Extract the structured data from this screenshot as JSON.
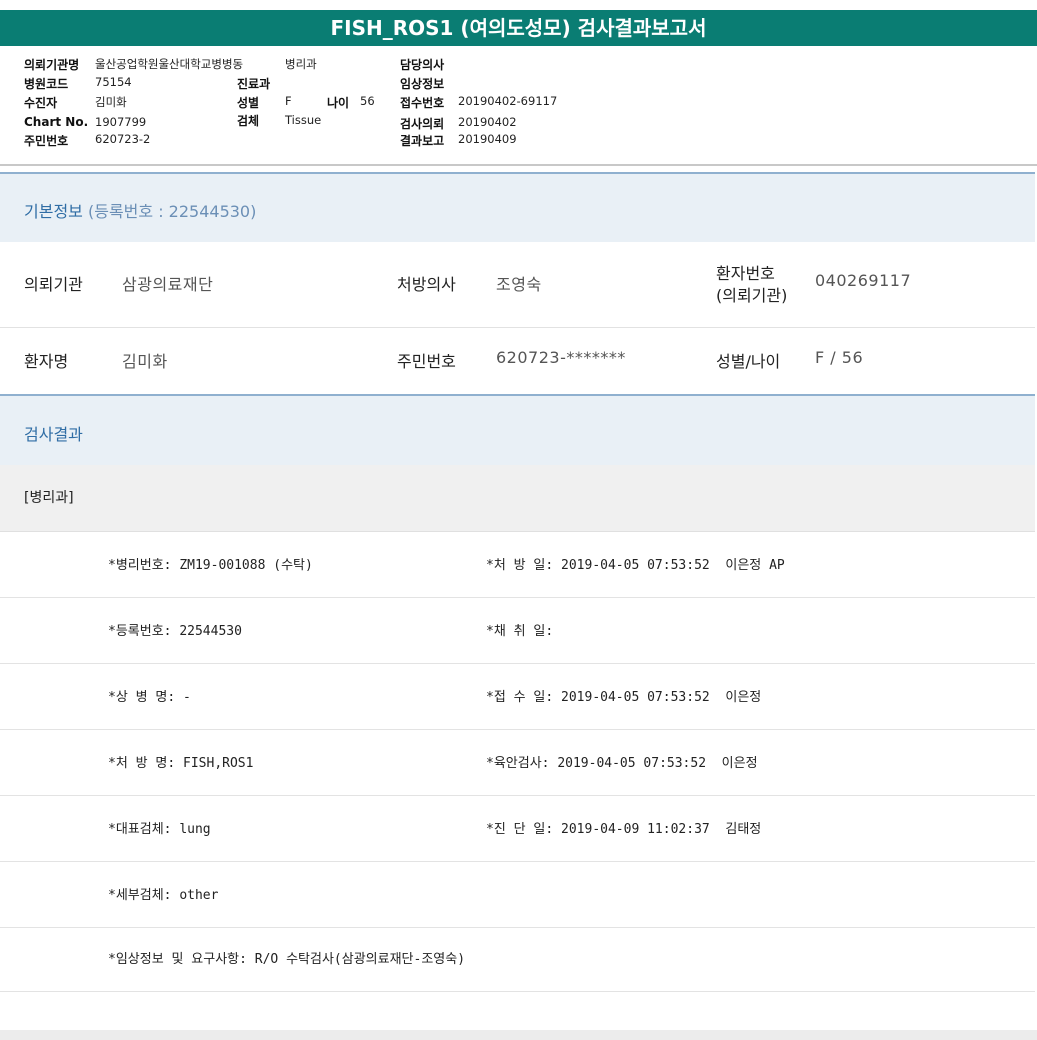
{
  "title": "FISH_ROS1 (여의도성모) 검사결과보고서",
  "header": {
    "requesting_institution": {
      "label": "의뢰기관명",
      "value": "울산공업학원울산대학교병병동"
    },
    "department": {
      "value": "병리과"
    },
    "attending_doctor": {
      "label": "담당의사",
      "value": ""
    },
    "hospital_code": {
      "label": "병원코드",
      "value": "75154"
    },
    "clinic": {
      "label": "진료과",
      "value": ""
    },
    "clinical_info": {
      "label": "임상정보",
      "value": ""
    },
    "patient": {
      "label": "수진자",
      "value": "김미화"
    },
    "sex": {
      "label": "성별",
      "value": "F"
    },
    "age": {
      "label": "나이",
      "value": "56"
    },
    "receipt_no": {
      "label": "접수번호",
      "value": "20190402-69117"
    },
    "chart_no": {
      "label": "Chart No.",
      "value": "1907799"
    },
    "specimen": {
      "label": "검체",
      "value": "Tissue"
    },
    "test_request": {
      "label": "검사의뢰",
      "value": "20190402"
    },
    "resident_no": {
      "label": "주민번호",
      "value": "620723-2"
    },
    "result_report": {
      "label": "결과보고",
      "value": "20190409"
    }
  },
  "basic_info": {
    "title": "기본정보",
    "reg_label": "(등록번호 : 22544530)",
    "row1": {
      "inst_label": "의뢰기관",
      "inst_value": "삼광의료재단",
      "doctor_label": "처방의사",
      "doctor_value": "조영숙",
      "pno_label_1": "환자번호",
      "pno_label_2": "(의뢰기관)",
      "pno_value": "040269117"
    },
    "row2": {
      "name_label": "환자명",
      "name_value": "김미화",
      "rrn_label": "주민번호",
      "rrn_value": "620723-*******",
      "sexage_label": "성별/나이",
      "sexage_value": "F / 56"
    }
  },
  "results": {
    "title": "검사결과",
    "department": "[병리과]",
    "rows": [
      {
        "left": "*병리번호: ZM19-001088 (수탁)",
        "right": "*처 방 일: 2019-04-05 07:53:52  이은정 AP"
      },
      {
        "left": "*등록번호: 22544530",
        "right": "*채 취 일:"
      },
      {
        "left": "*상 병 명: -",
        "right": "*접 수 일: 2019-04-05 07:53:52  이은정"
      },
      {
        "left": "*처 방 명: FISH,ROS1",
        "right": "*육안검사: 2019-04-05 07:53:52  이은정"
      },
      {
        "left": "*대표검체: lung",
        "right": "*진 단 일: 2019-04-09 11:02:37  김태정"
      },
      {
        "left": "*세부검체: other",
        "right": ""
      },
      {
        "left": "*임상정보 및 요구사항: R/O 수탁검사(삼광의료재단-조영숙)",
        "right": ""
      }
    ]
  }
}
